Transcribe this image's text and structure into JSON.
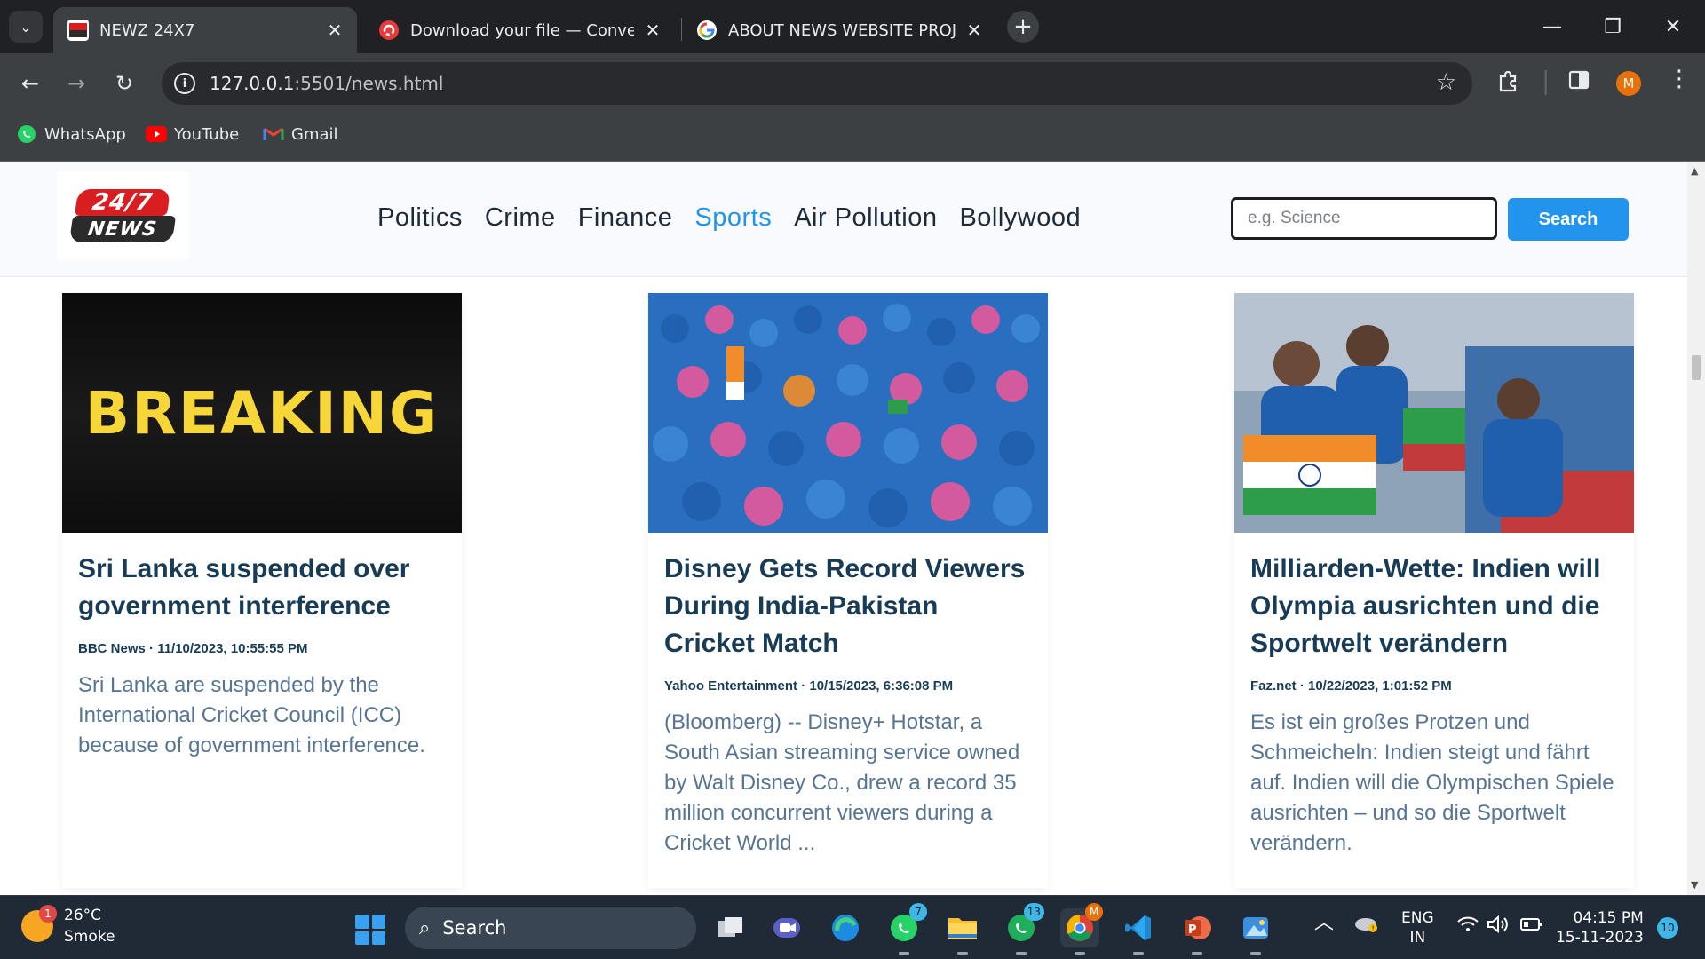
{
  "browser": {
    "tabs": [
      {
        "title": "NEWZ 24X7",
        "active": true,
        "favicon": "newz-favicon"
      },
      {
        "title": "Download your file — Convertio",
        "active": false,
        "favicon": "convertio-favicon"
      },
      {
        "title": "ABOUT NEWS WEBSITE PROJECT",
        "active": false,
        "favicon": "google-favicon"
      }
    ],
    "url_host": "127.0.0.1",
    "url_path": ":5501/news.html",
    "profile_initial": "M",
    "bookmarks": [
      {
        "label": "WhatsApp",
        "icon": "whatsapp-icon"
      },
      {
        "label": "YouTube",
        "icon": "youtube-icon"
      },
      {
        "label": "Gmail",
        "icon": "gmail-icon"
      }
    ]
  },
  "site": {
    "logo_top": "24/7",
    "logo_bottom": "NEWS",
    "nav": [
      {
        "label": "Politics",
        "active": false
      },
      {
        "label": "Crime",
        "active": false
      },
      {
        "label": "Finance",
        "active": false
      },
      {
        "label": "Sports",
        "active": true
      },
      {
        "label": "Air Pollution",
        "active": false
      },
      {
        "label": "Bollywood",
        "active": false
      }
    ],
    "search_placeholder": "e.g. Science",
    "search_button": "Search",
    "accent_color": "#2294ed"
  },
  "articles": [
    {
      "image_text": "BREAKING",
      "title": "Sri Lanka suspended over government interference",
      "meta": "BBC News · 11/10/2023, 10:55:55 PM",
      "description": "Sri Lanka are suspended by the International Cricket Council (ICC) because of government interference."
    },
    {
      "image_text": "",
      "title": "Disney Gets Record Viewers During India-Pakistan Cricket Match",
      "meta": "Yahoo Entertainment · 10/15/2023, 6:36:08 PM",
      "description": "(Bloomberg) -- Disney+ Hotstar, a South Asian streaming service owned by Walt Disney Co., drew a record 35 million concurrent viewers during a Cricket World ..."
    },
    {
      "image_text": "",
      "title": "Milliarden-Wette: Indien will Olympia ausrichten und die Sportwelt verändern",
      "meta": "Faz.net · 10/22/2023, 1:01:52 PM",
      "description": "Es ist ein großes Protzen und Schmeicheln: Indien steigt und fährt auf. Indien will die Olympischen Spiele ausrichten – und so die Sportwelt verändern."
    }
  ],
  "taskbar": {
    "weather_temp": "26°C",
    "weather_desc": "Smoke",
    "weather_badge": "1",
    "search_label": "Search",
    "whatsapp_badge": "7",
    "whatsapp2_badge": "13",
    "chrome_badge": "M",
    "lang_top": "ENG",
    "lang_bottom": "IN",
    "time": "04:15 PM",
    "date": "15-11-2023",
    "notifications": "10"
  }
}
